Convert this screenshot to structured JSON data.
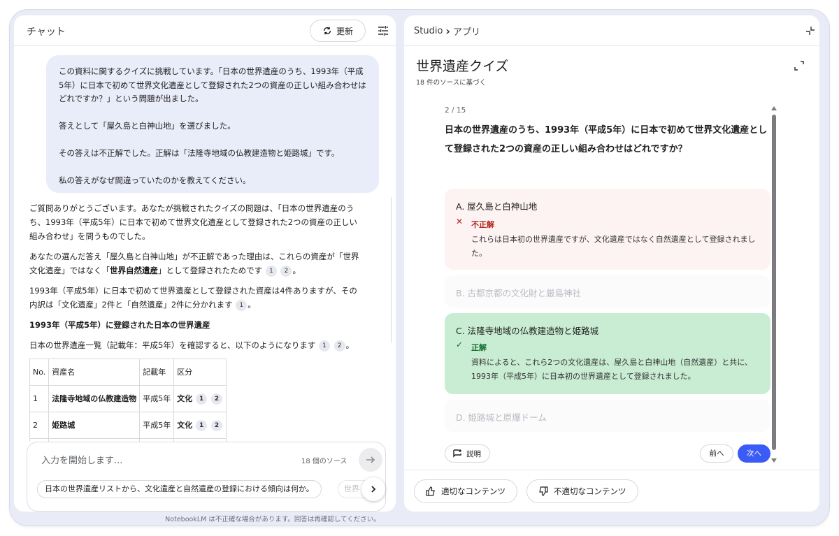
{
  "chat": {
    "title": "チャット",
    "refresh_label": "更新",
    "user_message": [
      "この資料に関するクイズに挑戦しています。「日本の世界遺産のうち、1993年（平成5年）に日本で初めて世界文化遺産として登録された2つの資産の正しい組み合わせはどれですか？」という問題が出ました。",
      "答えとして「屋久島と白神山地」を選びました。",
      "その答えは不正解でした。正解は「法隆寺地域の仏教建造物と姫路城」です。",
      "私の答えがなぜ間違っていたのかを教えてください。"
    ],
    "answer": {
      "p1": "ご質問ありがとうございます。あなたが挑戦されたクイズの問題は、「日本の世界遺産のうち、1993年（平成5年）に日本で初めて世界文化遺産として登録された2つの資産の正しい組み合わせ」を問うものでした。",
      "p2_a": "あなたの選んだ答え「屋久島と白神山地」が不正解であった理由は、これらの資産が「世界文化遺産」ではなく「",
      "p2_bold": "世界自然遺産",
      "p2_b": "」として登録されたためです",
      "p3": "1993年（平成5年）に日本で初めて世界遺産として登録された資産は4件ありますが、その内訳は「文化遺産」2件と「自然遺産」2件に分かれます",
      "heading": "1993年（平成5年）に登録された日本の世界遺産",
      "p4": "日本の世界遺産一覧（記載年：平成5年）を確認すると、以下のようになります",
      "cite1": "1",
      "cite2": "2",
      "period": "。",
      "table": {
        "headers": [
          "No.",
          "資産名",
          "記載年",
          "区分"
        ],
        "rows": [
          {
            "no": "1",
            "name": "法隆寺地域の仏教建造物",
            "year": "平成5年",
            "type": "文化"
          },
          {
            "no": "2",
            "name": "姫路城",
            "year": "平成5年",
            "type": "文化"
          }
        ]
      }
    },
    "composer": {
      "placeholder": "入力を開始します...",
      "source_count": "18 個のソース",
      "suggestion": "日本の世界遺産リストから、文化遺産と自然遺産の登録における傾向は何か。",
      "suggestion_2": "世界"
    },
    "disclaimer": "NotebookLM は不正確な場合があります。回答は再確認してください。"
  },
  "studio": {
    "breadcrumb_root": "Studio",
    "breadcrumb_sep": "›",
    "breadcrumb_current": "アプリ",
    "quiz_title": "世界遺産クイズ",
    "quiz_subtitle": "18 件のソースに基づく",
    "counter": "2 / 15",
    "question": "日本の世界遺産のうち、1993年（平成5年）に日本で初めて世界文化遺産として登録された2つの資産の正しい組み合わせはどれですか？",
    "options": [
      {
        "label": "A.  屋久島と白神山地",
        "status": "不正解",
        "mark": "✕",
        "explanation": "これらは日本初の世界遺産ですが、文化遺産ではなく自然遺産として登録されました。"
      },
      {
        "label": "B.  古都京都の文化財と厳島神社"
      },
      {
        "label": "C.  法隆寺地域の仏教建造物と姫路城",
        "status": "正解",
        "mark": "✓",
        "explanation": "資料によると、これら2つの文化遺産は、屋久島と白神山地（自然遺産）と共に、1993年（平成5年）に日本初の世界遺産として登録されました。"
      },
      {
        "label": "D.  姫路城と原爆ドーム"
      }
    ],
    "explain_label": "説明",
    "prev_label": "前へ",
    "next_label": "次へ",
    "good_content_label": "適切なコンテンツ",
    "bad_content_label": "不適切なコンテンツ",
    "colors": {
      "wrong": "#b3261e",
      "correct": "#146c2e",
      "primary": "#3b5bf6"
    }
  }
}
